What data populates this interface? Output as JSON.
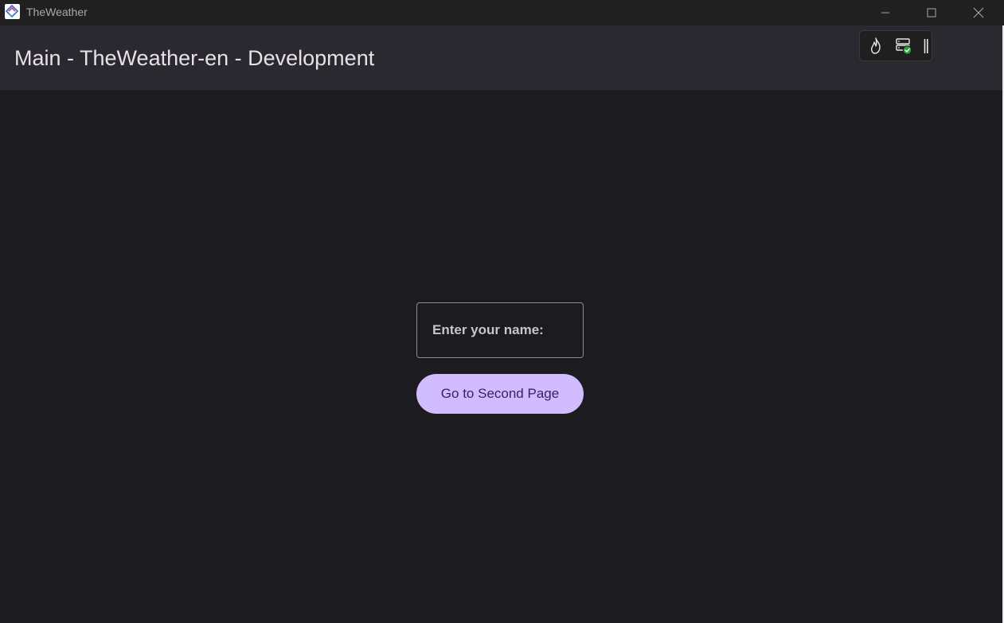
{
  "window": {
    "title": "TheWeather",
    "controls": {
      "minimize_icon": "minimize-icon",
      "maximize_icon": "maximize-icon",
      "close_icon": "close-icon"
    }
  },
  "appbar": {
    "title": "Main - TheWeather-en - Development",
    "devtools": {
      "icons": [
        "flame-icon",
        "server-check-icon",
        "drag-handle-icon"
      ]
    }
  },
  "main": {
    "name_field": {
      "label": "Enter your name:",
      "value": ""
    },
    "go_button": {
      "label": "Go to Second Page"
    }
  },
  "colors": {
    "background": "#1c1b1f",
    "appbar": "#2b2930",
    "titlebar": "#202020",
    "primary": "#d0bcff",
    "on_primary": "#381e72",
    "outline": "#8f8b93",
    "status_ok": "#1fa339"
  }
}
